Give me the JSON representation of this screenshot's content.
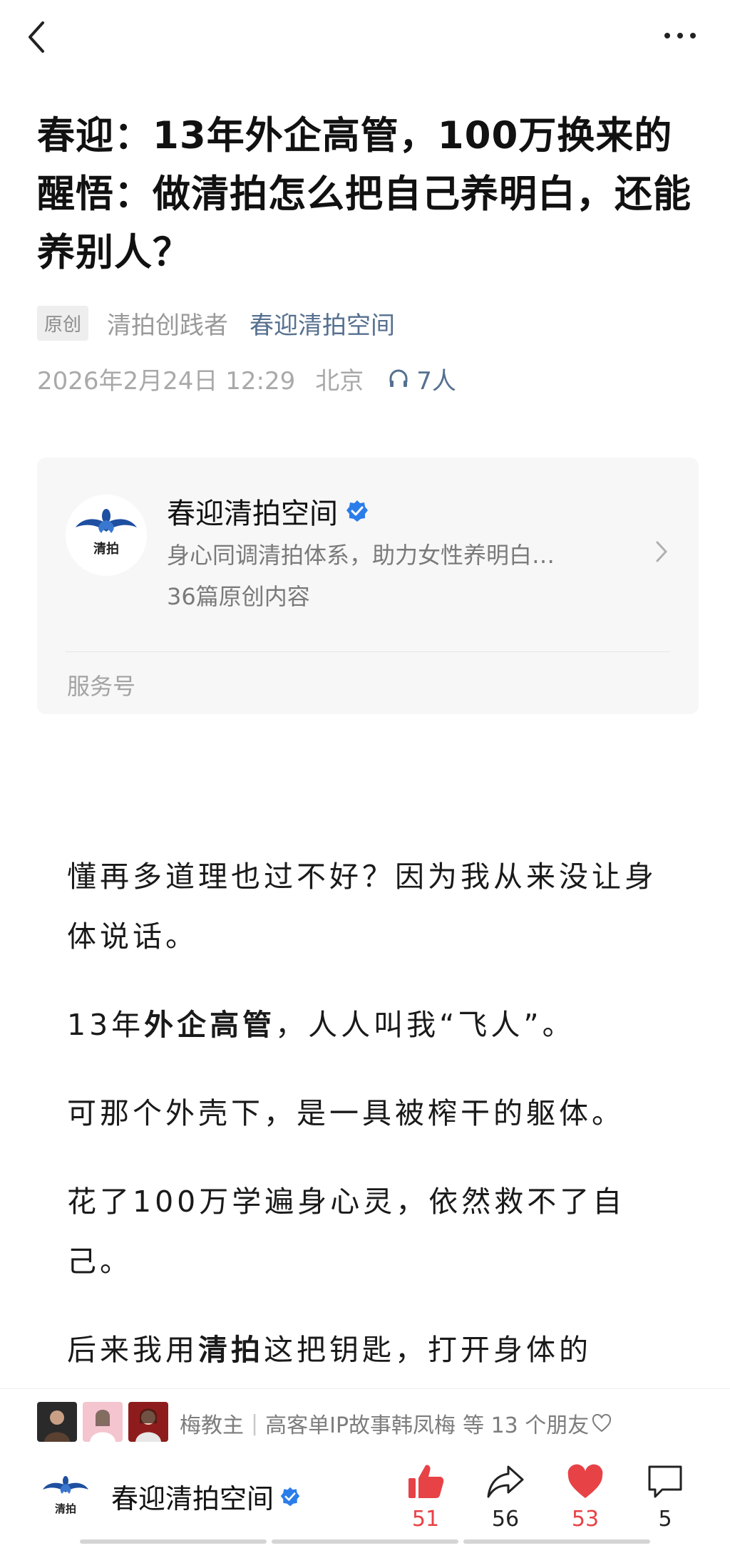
{
  "nav": {
    "back_icon": "chevron-left-icon",
    "more_icon": "more-dots-icon"
  },
  "article": {
    "title": "春迎：13年外企高管，100万换来的醒悟：做清拍怎么把自己养明白，还能养别人？",
    "original_tag": "原创",
    "author": "清拍创践者",
    "account_link": "春迎清拍空间",
    "date": "2026年2月24日 12:29",
    "location": "北京",
    "listeners": "7人"
  },
  "account_card": {
    "logo_text": "清拍",
    "name": "春迎清拍空间",
    "description": "身心同调清拍体系，助力女性养明白…",
    "count": "36篇原创内容",
    "type": "服务号"
  },
  "body": {
    "p1": "懂再多道理也过不好？因为我从来没让身体说话。",
    "p2_a": "13年",
    "p2_bold": "外企高管",
    "p2_b": "，人人叫我“飞人”。",
    "p3": "可那个外壳下，是一具被榨干的躯体。",
    "p4": "花了100万学遍身心灵，依然救不了自己。",
    "p5_a": "后来我用",
    "p5_bold": "清拍",
    "p5_b": "这把钥匙，打开身体的"
  },
  "social": {
    "friend1": "梅教主",
    "friend2": "高客单IP故事韩凤梅",
    "suffix": "等 13 个朋友"
  },
  "bottom": {
    "logo_text": "清拍",
    "name": "春迎清拍空间",
    "like_count": "51",
    "share_count": "56",
    "love_count": "53",
    "comment_count": "5",
    "colors": {
      "accent_red": "#e74246",
      "link_blue": "#56708f",
      "verified_blue": "#2b7de9"
    }
  }
}
